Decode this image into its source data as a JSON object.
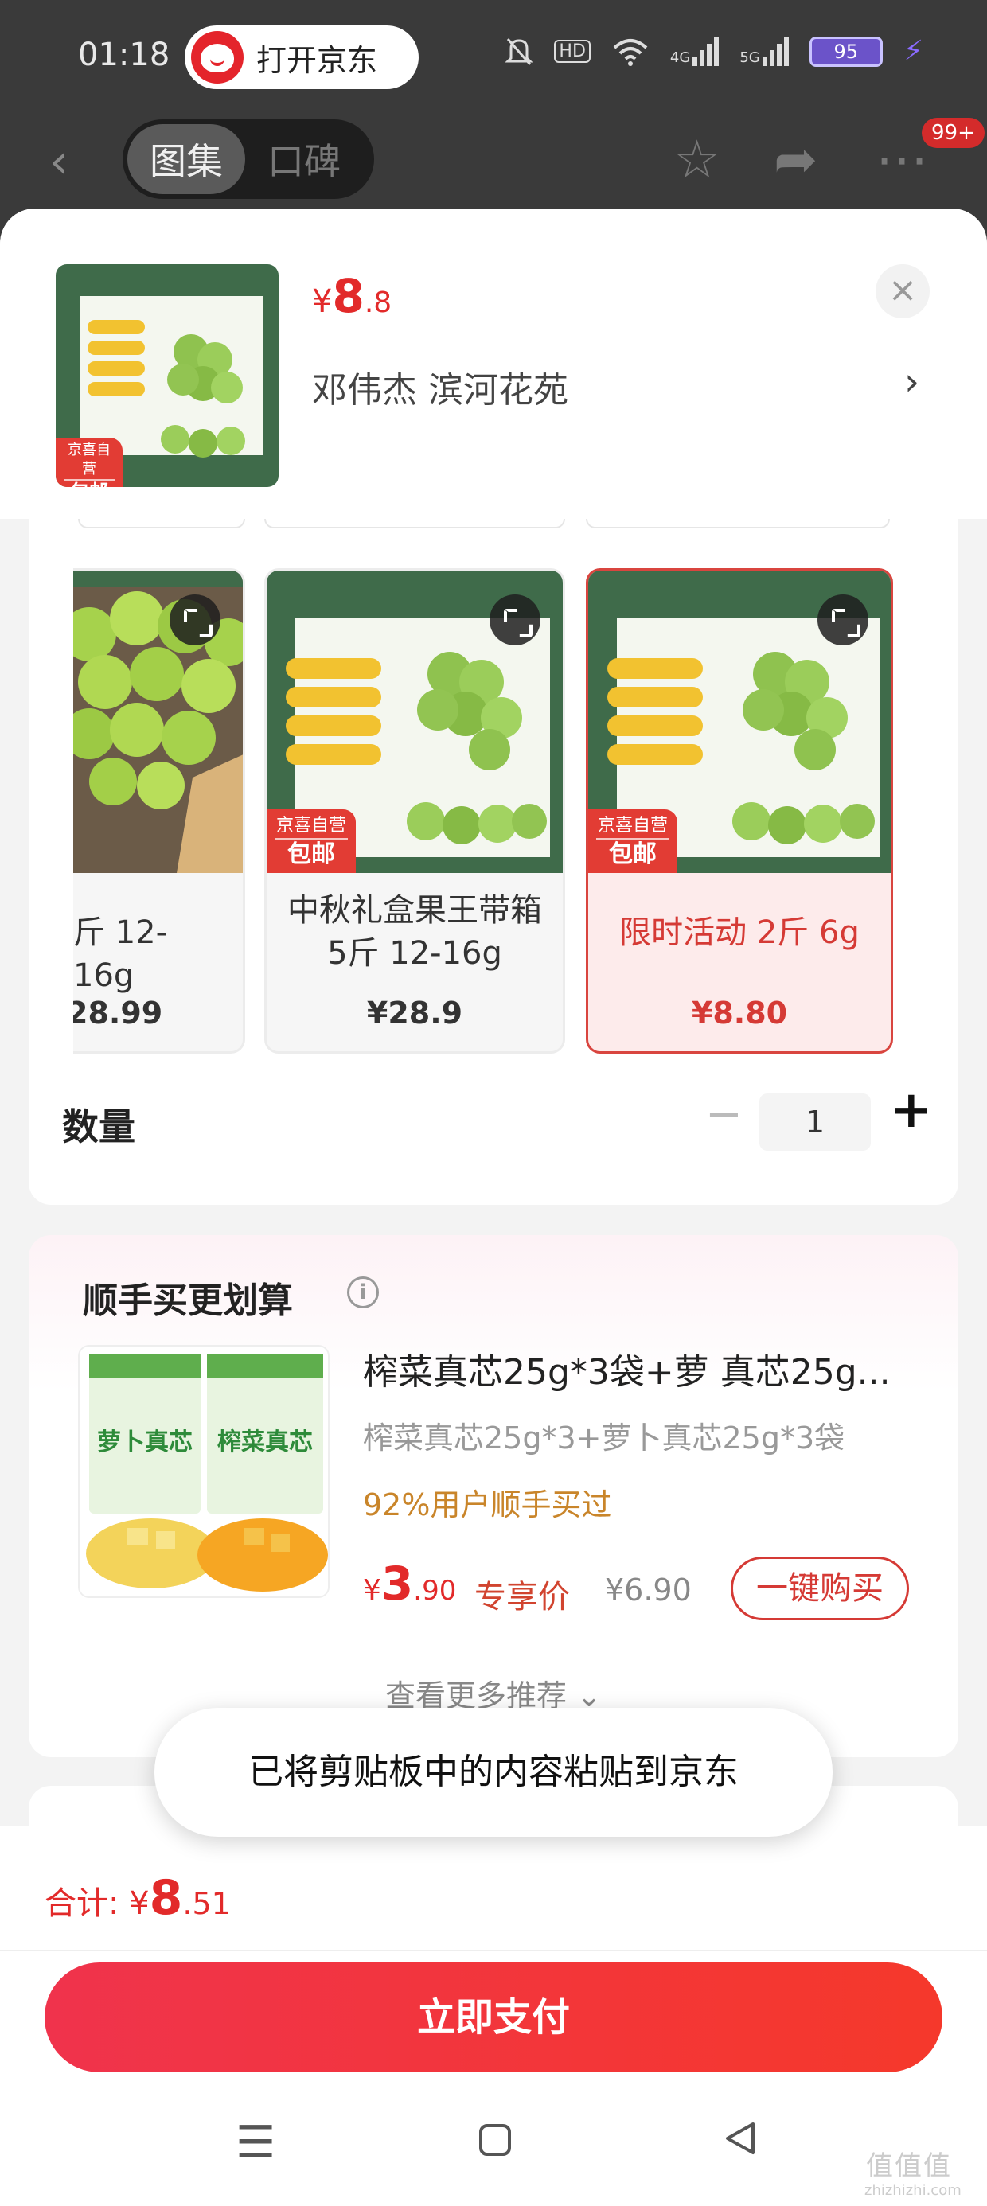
{
  "status_bar": {
    "time": "01:18",
    "app_pill": "打开京东",
    "battery": "95",
    "network": "4G",
    "network2": "5G",
    "hd": "HD"
  },
  "nav": {
    "tab_gallery": "图集",
    "tab_reviews": "口碑",
    "badge": "99+"
  },
  "product": {
    "price_currency": "¥",
    "price_int": "8",
    "price_dec": ".8",
    "address": "邓伟杰  滨河花苑",
    "thumb_tag_top": "京喜自营",
    "thumb_tag_bottom": "包邮"
  },
  "skus": [
    {
      "name": "斤 12-16g",
      "price": "28.99",
      "tag_top": "",
      "tag_bottom": "",
      "selected": false
    },
    {
      "name": "中秋礼盒果王带箱 5斤 12-16g",
      "price": "¥28.9",
      "tag_top": "京喜自营",
      "tag_bottom": "包邮",
      "selected": false
    },
    {
      "name": "限时活动 2斤 6g",
      "price": "¥8.80",
      "tag_top": "京喜自营",
      "tag_bottom": "包邮",
      "selected": true
    }
  ],
  "quantity": {
    "label": "数量",
    "minus": "−",
    "value": "1",
    "plus": "+"
  },
  "recommend": {
    "title": "顺手买更划算",
    "item_name": "榨菜真芯25g*3袋+萝 真芯25g...",
    "item_sub": "榨菜真芯25g*3+萝卜真芯25g*3袋",
    "item_rate": "92%用户顺手买过",
    "price_currency": "¥",
    "price_int": "3",
    "price_dec": ".90",
    "price_label": "专享价",
    "original_price": "¥6.90",
    "buy_label": "一键购买",
    "see_more": "查看更多推荐 ⌄"
  },
  "toast": "已将剪贴板中的内容粘贴到京东",
  "footer": {
    "total_label": "合计: ",
    "total_currency": "¥",
    "total_int": "8",
    "total_dec": ".51",
    "pay_label": "立即支付"
  },
  "watermark": "值值值",
  "watermark_sub": "zhizhizhi.com",
  "colors": {
    "accent_red": "#e22a2a",
    "pay_gradient_start": "#f0334c",
    "pay_gradient_end": "#f5382b",
    "selected_bg": "#fdebeb",
    "rate_orange": "#c9852a"
  }
}
